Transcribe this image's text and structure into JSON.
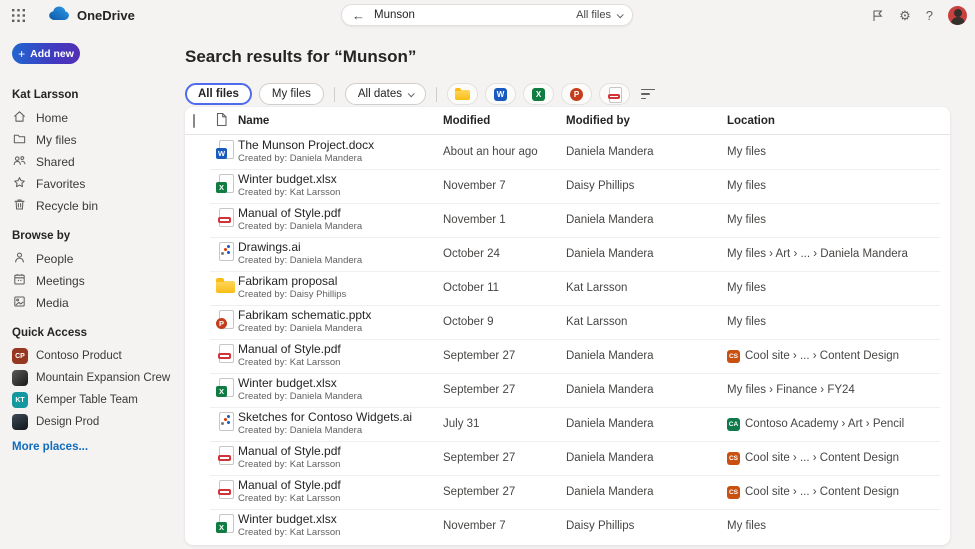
{
  "topbar": {
    "app_name": "OneDrive",
    "search": {
      "query": "Munson",
      "scope": "All files"
    },
    "help_label": "?"
  },
  "sidebar": {
    "add_new_label": "Add new",
    "user_name": "Kat Larsson",
    "nav": [
      {
        "label": "Home"
      },
      {
        "label": "My files"
      },
      {
        "label": "Shared"
      },
      {
        "label": "Favorites"
      },
      {
        "label": "Recycle bin"
      }
    ],
    "browse_by_label": "Browse by",
    "browse": [
      {
        "label": "People"
      },
      {
        "label": "Meetings"
      },
      {
        "label": "Media"
      }
    ],
    "quick_access_label": "Quick Access",
    "quick_access": [
      {
        "label": "Contoso Product",
        "initials": "CP",
        "avatar_bg": "#963821"
      },
      {
        "label": "Mountain Expansion Crew",
        "initials": "",
        "avatar_bg": "linear-gradient(135deg,#5a5a58,#191917)"
      },
      {
        "label": "Kemper Table Team",
        "initials": "KT",
        "avatar_bg": "#1498a0"
      },
      {
        "label": "Design Prod",
        "initials": "",
        "avatar_bg": "linear-gradient(150deg,#3d4a57,#11151a)"
      }
    ],
    "more_places_label": "More places..."
  },
  "main": {
    "title": "Search results for “Munson”",
    "pills": {
      "all_files": "All files",
      "my_files": "My files",
      "all_dates": "All dates"
    },
    "table": {
      "columns": {
        "name": "Name",
        "modified": "Modified",
        "modified_by": "Modified by",
        "location": "Location"
      },
      "rows": [
        {
          "type": "word",
          "name": "The Munson Project.docx",
          "created": "Created by: Daniela Mandera",
          "modified": "About an hour ago",
          "modified_by": "Daniela Mandera",
          "location": "My files",
          "badge": null
        },
        {
          "type": "excel",
          "name": "Winter budget.xlsx",
          "created": "Created by: Kat Larsson",
          "modified": "November 7",
          "modified_by": "Daisy Phillips",
          "location": "My files",
          "badge": null
        },
        {
          "type": "pdf",
          "name": "Manual of Style.pdf",
          "created": "Created by: Daniela Mandera",
          "modified": "November 1",
          "modified_by": "Daniela Mandera",
          "location": "My files",
          "badge": null
        },
        {
          "type": "ai",
          "name": "Drawings.ai",
          "created": "Created by: Daniela Mandera",
          "modified": "October 24",
          "modified_by": "Daniela Mandera",
          "location": "My files › Art › ... › Daniela Mandera",
          "badge": null
        },
        {
          "type": "folder",
          "name": "Fabrikam proposal",
          "created": "Created by: Daisy Phillips",
          "modified": "October 11",
          "modified_by": "Kat Larsson",
          "location": "My files",
          "badge": null
        },
        {
          "type": "ppt",
          "name": "Fabrikam schematic.pptx",
          "created": "Created by: Daniela Mandera",
          "modified": "October 9",
          "modified_by": "Kat Larsson",
          "location": "My files",
          "badge": null
        },
        {
          "type": "pdf",
          "name": "Manual of Style.pdf",
          "created": "Created by: Kat Larsson",
          "modified": "September 27",
          "modified_by": "Daniela Mandera",
          "location": "Cool site › ... › Content Design",
          "badge": {
            "text": "CS",
            "color": "#ca5010"
          }
        },
        {
          "type": "excel",
          "name": "Winter budget.xlsx",
          "created": "Created by: Daniela Mandera",
          "modified": "September 27",
          "modified_by": "Daniela Mandera",
          "location": "My files › Finance › FY24",
          "badge": null
        },
        {
          "type": "ai",
          "name": "Sketches for Contoso Widgets.ai",
          "created": "Created by: Daniela Mandera",
          "modified": "July 31",
          "modified_by": "Daniela Mandera",
          "location": "Contoso Academy › Art › Pencil",
          "badge": {
            "text": "CA",
            "color": "#0e7a4b"
          }
        },
        {
          "type": "pdf",
          "name": "Manual of Style.pdf",
          "created": "Created by: Kat Larsson",
          "modified": "September 27",
          "modified_by": "Daniela Mandera",
          "location": "Cool site › ... › Content Design",
          "badge": {
            "text": "CS",
            "color": "#ca5010"
          }
        },
        {
          "type": "pdf",
          "name": "Manual of Style.pdf",
          "created": "Created by: Kat Larsson",
          "modified": "September 27",
          "modified_by": "Daniela Mandera",
          "location": "Cool site › ... › Content Design",
          "badge": {
            "text": "CS",
            "color": "#ca5010"
          }
        },
        {
          "type": "excel",
          "name": "Winter budget.xlsx",
          "created": "Created by: Kat Larsson",
          "modified": "November 7",
          "modified_by": "Daisy Phillips",
          "location": "My files",
          "badge": null
        }
      ]
    }
  },
  "colors": {
    "accent": "#0f6cbd",
    "selected_pill_border": "#4f6bed",
    "word": "#185abd",
    "excel": "#107c41",
    "powerpoint": "#c43e1c",
    "pdf": "#d13438",
    "folder": "#f9bd15"
  }
}
